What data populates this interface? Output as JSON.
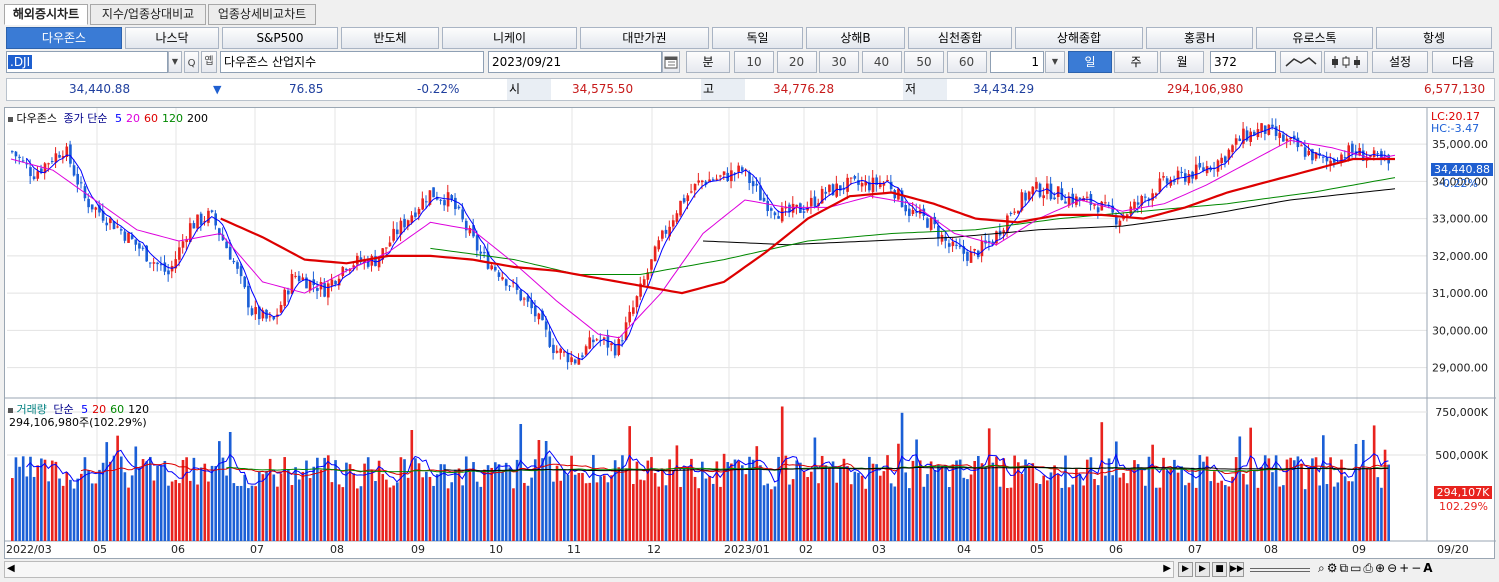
{
  "tabs": [
    "해외증시차트",
    "지수/업종상대비교",
    "업종상세비교차트"
  ],
  "markets": [
    "다우존스",
    "나스닥",
    "S&P500",
    "반도체",
    "니케이",
    "대만가권",
    "독일",
    "상해B",
    "심천종합",
    "상해종합",
    "홍콩H",
    "유로스톡",
    "항셍"
  ],
  "toolbar": {
    "symbol_code": ".DJI",
    "search_label": "Q",
    "memo_label": "옙",
    "symbol_name": "다우존스 산업지수",
    "date": "2023/09/21",
    "minute_label": "분",
    "intervals": [
      "10",
      "20",
      "30",
      "40",
      "50",
      "60"
    ],
    "count_value": "1",
    "periods": [
      "일",
      "주",
      "월"
    ],
    "bar_count": "372",
    "settings_label": "설정",
    "next_label": "다음"
  },
  "quote": {
    "price": "34,440.88",
    "arrow": "▼",
    "change": "76.85",
    "change_pct": "-0.22%",
    "open_label": "시",
    "open": "34,575.50",
    "high_label": "고",
    "high": "34,776.28",
    "low_label": "저",
    "low": "34,434.29",
    "volume": "294,106,980",
    "amount": "6,577,130"
  },
  "price_legend": {
    "name": "다우존스",
    "ma_label": "종가 단순",
    "ma": [
      {
        "p": "5",
        "c": "#0000ff"
      },
      {
        "p": "20",
        "c": "#dd00dd"
      },
      {
        "p": "60",
        "c": "#dd0000"
      },
      {
        "p": "120",
        "c": "#008800"
      },
      {
        "p": "200",
        "c": "#000000"
      }
    ]
  },
  "price_right": {
    "lc": "LC:20.17",
    "hc": "HC:-3.47",
    "cur": "34,440.88",
    "pct": "-0.22%"
  },
  "volume_legend": {
    "name": "거래량",
    "ma_label": "단순",
    "ma": [
      {
        "p": "5",
        "c": "#0000ff"
      },
      {
        "p": "20",
        "c": "#dd0000"
      },
      {
        "p": "60",
        "c": "#008800"
      },
      {
        "p": "120",
        "c": "#000000"
      }
    ],
    "value": "294,106,980주(102.29%)"
  },
  "volume_right": {
    "cur": "294,107K",
    "pct": "102.29%"
  },
  "colors": {
    "up": "#e8231e",
    "down": "#1b5fd6",
    "ma5": "#0000ff",
    "ma20": "#dd00dd",
    "ma60": "#dd0000",
    "ma120": "#008800",
    "ma200": "#000000"
  },
  "chart_data": [
    {
      "type": "candlestick",
      "title": "다우존스",
      "y_axis": {
        "ticks": [
          "35,000.00",
          "34,000.00",
          "33,000.00",
          "32,000.00",
          "31,000.00",
          "30,000.00",
          "29,000.00"
        ],
        "range": [
          28400,
          35700
        ]
      },
      "x_labels": [
        "2022/03",
        "05",
        "06",
        "07",
        "08",
        "09",
        "10",
        "11",
        "12",
        "2023/01",
        "02",
        "03",
        "04",
        "05",
        "06",
        "07",
        "08",
        "09",
        "09/20"
      ],
      "close_path": [
        {
          "t": 0,
          "v": 34800
        },
        {
          "t": 2,
          "v": 34200
        },
        {
          "t": 5,
          "v": 34900
        },
        {
          "t": 7,
          "v": 33500
        },
        {
          "t": 10,
          "v": 32800
        },
        {
          "t": 13,
          "v": 32000
        },
        {
          "t": 15,
          "v": 31500
        },
        {
          "t": 17,
          "v": 32800
        },
        {
          "t": 19,
          "v": 33100
        },
        {
          "t": 21,
          "v": 32000
        },
        {
          "t": 23,
          "v": 30500
        },
        {
          "t": 25,
          "v": 30200
        },
        {
          "t": 27,
          "v": 31500
        },
        {
          "t": 30,
          "v": 31100
        },
        {
          "t": 32,
          "v": 31800
        },
        {
          "t": 35,
          "v": 31900
        },
        {
          "t": 37,
          "v": 32700
        },
        {
          "t": 40,
          "v": 33700
        },
        {
          "t": 42,
          "v": 33500
        },
        {
          "t": 45,
          "v": 32000
        },
        {
          "t": 47,
          "v": 31500
        },
        {
          "t": 50,
          "v": 30500
        },
        {
          "t": 52,
          "v": 29500
        },
        {
          "t": 54,
          "v": 29200
        },
        {
          "t": 56,
          "v": 29800
        },
        {
          "t": 58,
          "v": 29500
        },
        {
          "t": 60,
          "v": 30900
        },
        {
          "t": 62,
          "v": 32300
        },
        {
          "t": 64,
          "v": 33400
        },
        {
          "t": 66,
          "v": 34000
        },
        {
          "t": 68,
          "v": 34100
        },
        {
          "t": 70,
          "v": 34300
        },
        {
          "t": 72,
          "v": 33500
        },
        {
          "t": 74,
          "v": 33100
        },
        {
          "t": 76,
          "v": 33300
        },
        {
          "t": 78,
          "v": 33700
        },
        {
          "t": 80,
          "v": 33900
        },
        {
          "t": 82,
          "v": 33900
        },
        {
          "t": 84,
          "v": 34000
        },
        {
          "t": 86,
          "v": 33200
        },
        {
          "t": 88,
          "v": 32900
        },
        {
          "t": 90,
          "v": 32200
        },
        {
          "t": 92,
          "v": 32000
        },
        {
          "t": 94,
          "v": 32400
        },
        {
          "t": 96,
          "v": 33300
        },
        {
          "t": 98,
          "v": 33800
        },
        {
          "t": 100,
          "v": 33700
        },
        {
          "t": 102,
          "v": 33500
        },
        {
          "t": 104,
          "v": 33400
        },
        {
          "t": 106,
          "v": 33000
        },
        {
          "t": 108,
          "v": 33400
        },
        {
          "t": 110,
          "v": 33900
        },
        {
          "t": 112,
          "v": 34100
        },
        {
          "t": 114,
          "v": 34300
        },
        {
          "t": 116,
          "v": 34600
        },
        {
          "t": 118,
          "v": 35200
        },
        {
          "t": 120,
          "v": 35400
        },
        {
          "t": 122,
          "v": 35100
        },
        {
          "t": 124,
          "v": 34800
        },
        {
          "t": 126,
          "v": 34500
        },
        {
          "t": 128,
          "v": 34800
        },
        {
          "t": 130,
          "v": 34700
        },
        {
          "t": 132,
          "v": 34440
        }
      ]
    },
    {
      "type": "bar",
      "title": "거래량",
      "y_axis": {
        "ticks": [
          "750,000K",
          "500,000K"
        ],
        "range": [
          0,
          820000
        ]
      }
    }
  ],
  "ma_lines": {
    "ma20": [
      {
        "t": 0,
        "v": 34600
      },
      {
        "t": 4,
        "v": 34300
      },
      {
        "t": 8,
        "v": 33500
      },
      {
        "t": 12,
        "v": 32700
      },
      {
        "t": 16,
        "v": 32400
      },
      {
        "t": 20,
        "v": 32600
      },
      {
        "t": 24,
        "v": 31300
      },
      {
        "t": 28,
        "v": 31000
      },
      {
        "t": 32,
        "v": 31600
      },
      {
        "t": 36,
        "v": 32100
      },
      {
        "t": 40,
        "v": 32900
      },
      {
        "t": 44,
        "v": 32700
      },
      {
        "t": 48,
        "v": 31800
      },
      {
        "t": 52,
        "v": 30800
      },
      {
        "t": 56,
        "v": 29900
      },
      {
        "t": 58,
        "v": 29800
      },
      {
        "t": 62,
        "v": 31000
      },
      {
        "t": 66,
        "v": 32600
      },
      {
        "t": 70,
        "v": 33500
      },
      {
        "t": 74,
        "v": 33300
      },
      {
        "t": 78,
        "v": 33300
      },
      {
        "t": 82,
        "v": 33600
      },
      {
        "t": 86,
        "v": 33400
      },
      {
        "t": 90,
        "v": 32600
      },
      {
        "t": 94,
        "v": 32300
      },
      {
        "t": 98,
        "v": 33000
      },
      {
        "t": 102,
        "v": 33500
      },
      {
        "t": 106,
        "v": 33200
      },
      {
        "t": 110,
        "v": 33400
      },
      {
        "t": 114,
        "v": 33900
      },
      {
        "t": 118,
        "v": 34500
      },
      {
        "t": 122,
        "v": 35100
      },
      {
        "t": 126,
        "v": 34900
      },
      {
        "t": 130,
        "v": 34600
      },
      {
        "t": 132,
        "v": 34700
      }
    ],
    "ma60": [
      {
        "t": 20,
        "v": 33000
      },
      {
        "t": 24,
        "v": 32500
      },
      {
        "t": 28,
        "v": 31900
      },
      {
        "t": 32,
        "v": 31800
      },
      {
        "t": 36,
        "v": 32000
      },
      {
        "t": 40,
        "v": 32000
      },
      {
        "t": 44,
        "v": 31900
      },
      {
        "t": 48,
        "v": 31700
      },
      {
        "t": 52,
        "v": 31600
      },
      {
        "t": 56,
        "v": 31400
      },
      {
        "t": 60,
        "v": 31200
      },
      {
        "t": 64,
        "v": 31000
      },
      {
        "t": 68,
        "v": 31300
      },
      {
        "t": 72,
        "v": 32100
      },
      {
        "t": 76,
        "v": 33000
      },
      {
        "t": 80,
        "v": 33600
      },
      {
        "t": 84,
        "v": 33700
      },
      {
        "t": 88,
        "v": 33400
      },
      {
        "t": 92,
        "v": 33000
      },
      {
        "t": 96,
        "v": 32900
      },
      {
        "t": 100,
        "v": 33100
      },
      {
        "t": 104,
        "v": 33100
      },
      {
        "t": 108,
        "v": 33000
      },
      {
        "t": 112,
        "v": 33300
      },
      {
        "t": 116,
        "v": 33700
      },
      {
        "t": 120,
        "v": 34000
      },
      {
        "t": 124,
        "v": 34300
      },
      {
        "t": 128,
        "v": 34600
      },
      {
        "t": 132,
        "v": 34600
      }
    ],
    "ma120": [
      {
        "t": 40,
        "v": 32200
      },
      {
        "t": 48,
        "v": 31900
      },
      {
        "t": 54,
        "v": 31500
      },
      {
        "t": 60,
        "v": 31500
      },
      {
        "t": 68,
        "v": 31900
      },
      {
        "t": 76,
        "v": 32400
      },
      {
        "t": 84,
        "v": 32600
      },
      {
        "t": 92,
        "v": 32700
      },
      {
        "t": 100,
        "v": 33000
      },
      {
        "t": 108,
        "v": 33200
      },
      {
        "t": 116,
        "v": 33400
      },
      {
        "t": 124,
        "v": 33700
      },
      {
        "t": 132,
        "v": 34100
      }
    ],
    "ma200": [
      {
        "t": 66,
        "v": 32400
      },
      {
        "t": 74,
        "v": 32300
      },
      {
        "t": 82,
        "v": 32400
      },
      {
        "t": 90,
        "v": 32500
      },
      {
        "t": 98,
        "v": 32700
      },
      {
        "t": 106,
        "v": 32800
      },
      {
        "t": 114,
        "v": 33100
      },
      {
        "t": 122,
        "v": 33500
      },
      {
        "t": 132,
        "v": 33800
      }
    ]
  }
}
